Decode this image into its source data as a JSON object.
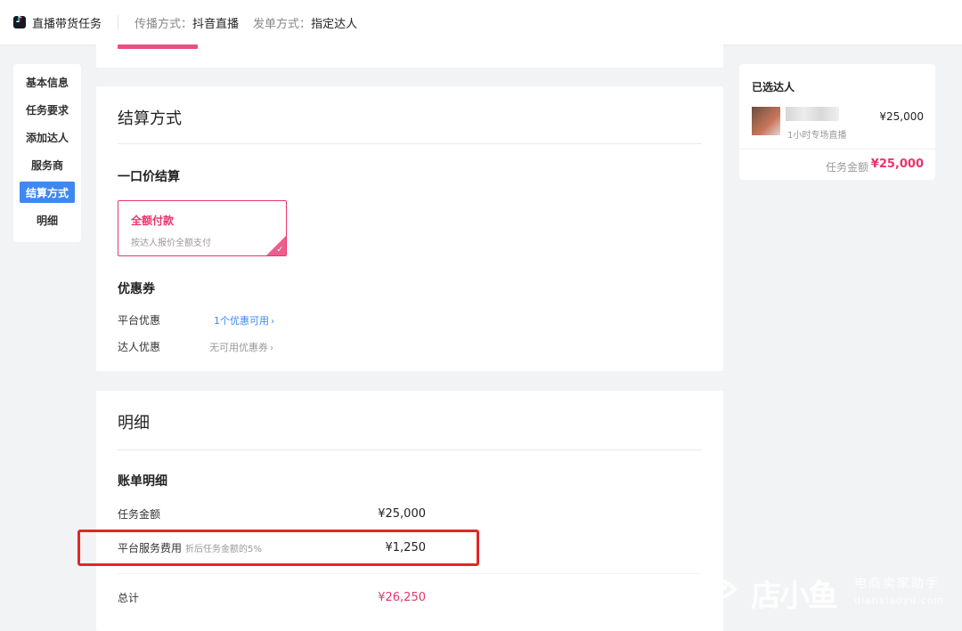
{
  "header": {
    "app_icon": "douyin-logo-icon",
    "app_title": "直播带货任务",
    "spread_label": "传播方式：",
    "spread_value": "抖音直播",
    "order_label": "发单方式：",
    "order_value": "指定达人"
  },
  "sidebar": {
    "items": [
      {
        "label": "基本信息",
        "active": false
      },
      {
        "label": "任务要求",
        "active": false
      },
      {
        "label": "添加达人",
        "active": false
      },
      {
        "label": "服务商",
        "active": false
      },
      {
        "label": "结算方式",
        "active": true
      },
      {
        "label": "明细",
        "active": false
      }
    ]
  },
  "settlement": {
    "title": "结算方式",
    "section_title": "一口价结算",
    "option": {
      "title": "全额付款",
      "desc": "按达人报价全额支付",
      "selected": true
    },
    "coupon_title": "优惠券",
    "platform_coupon_label": "平台优惠",
    "platform_coupon_value": "1个优惠可用",
    "kol_coupon_label": "达人优惠",
    "kol_coupon_value": "无可用优惠券"
  },
  "detail": {
    "title": "明细",
    "section_title": "账单明细",
    "rows": [
      {
        "label": "任务金额",
        "hint": "",
        "amount": "¥25,000"
      },
      {
        "label": "平台服务费用",
        "hint": "折后任务金额的5%",
        "amount": "¥1,250"
      }
    ],
    "total_label": "总计",
    "total_amount": "¥26,250"
  },
  "selected_panel": {
    "title": "已选达人",
    "item": {
      "subtitle": "1小时专场直播",
      "price": "¥25,000"
    },
    "total_label": "任务金额",
    "total_amount": "¥25,000"
  },
  "watermark": {
    "brand": "店小鱼",
    "slogan": "电商卖家助手",
    "domain": "dianxiaoyu.com"
  },
  "colors": {
    "accent_pink": "#e8356b",
    "active_blue": "#3d88f2",
    "highlight_red": "#e32626"
  }
}
